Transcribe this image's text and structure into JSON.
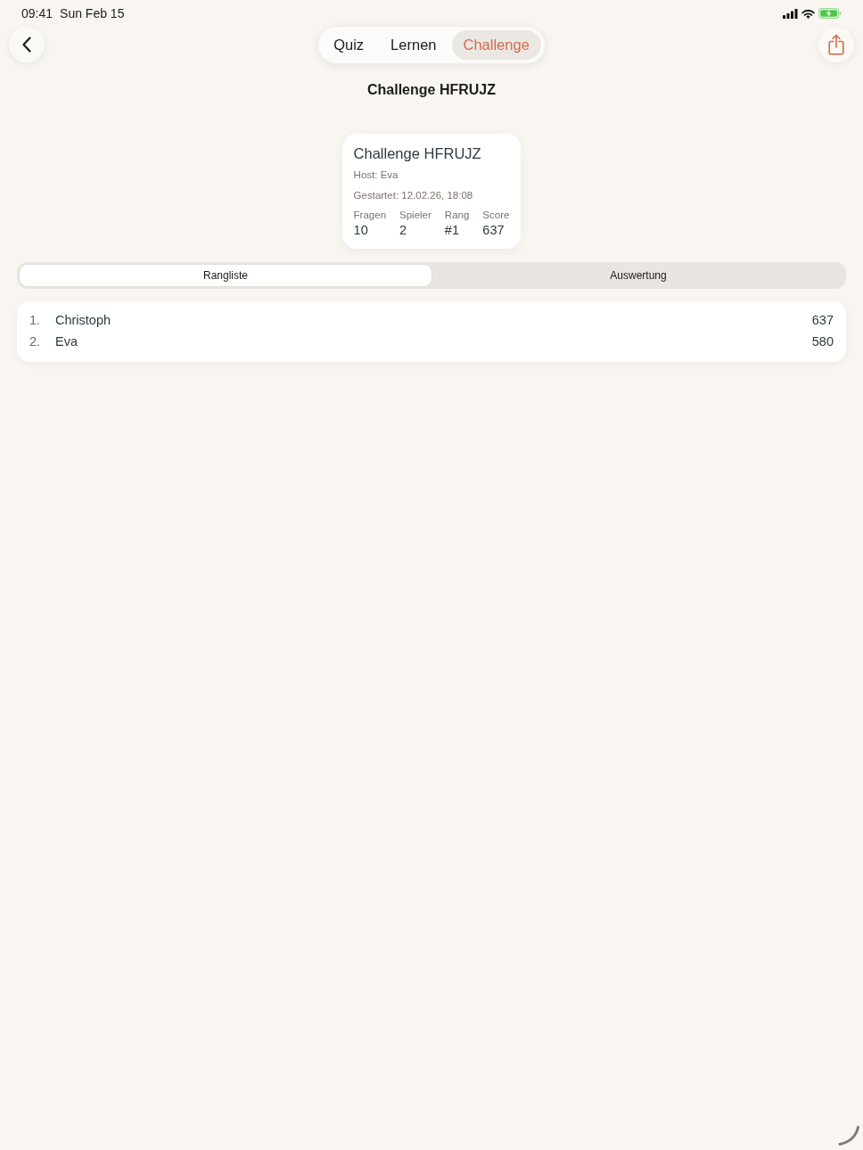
{
  "status_bar": {
    "time": "09:41",
    "date": "Sun Feb 15"
  },
  "nav": {
    "tabs": [
      {
        "label": "Quiz",
        "selected": false
      },
      {
        "label": "Lernen",
        "selected": false
      },
      {
        "label": "Challenge",
        "selected": true
      }
    ]
  },
  "title": "Challenge HFRUJZ",
  "summary_card": {
    "title": "Challenge HFRUJZ",
    "host": "Host: Eva",
    "started": "Gestartet: 12.02.26, 18:08",
    "stats": [
      {
        "label": "Fragen",
        "value": "10"
      },
      {
        "label": "Spieler",
        "value": "2"
      },
      {
        "label": "Rang",
        "value": "#1"
      },
      {
        "label": "Score",
        "value": "637"
      }
    ]
  },
  "segments": [
    {
      "label": "Rangliste",
      "selected": true
    },
    {
      "label": "Auswertung",
      "selected": false
    }
  ],
  "leaderboard": [
    {
      "rank": "1.",
      "name": "Christoph",
      "score": "637"
    },
    {
      "rank": "2.",
      "name": "Eva",
      "score": "580"
    }
  ]
}
